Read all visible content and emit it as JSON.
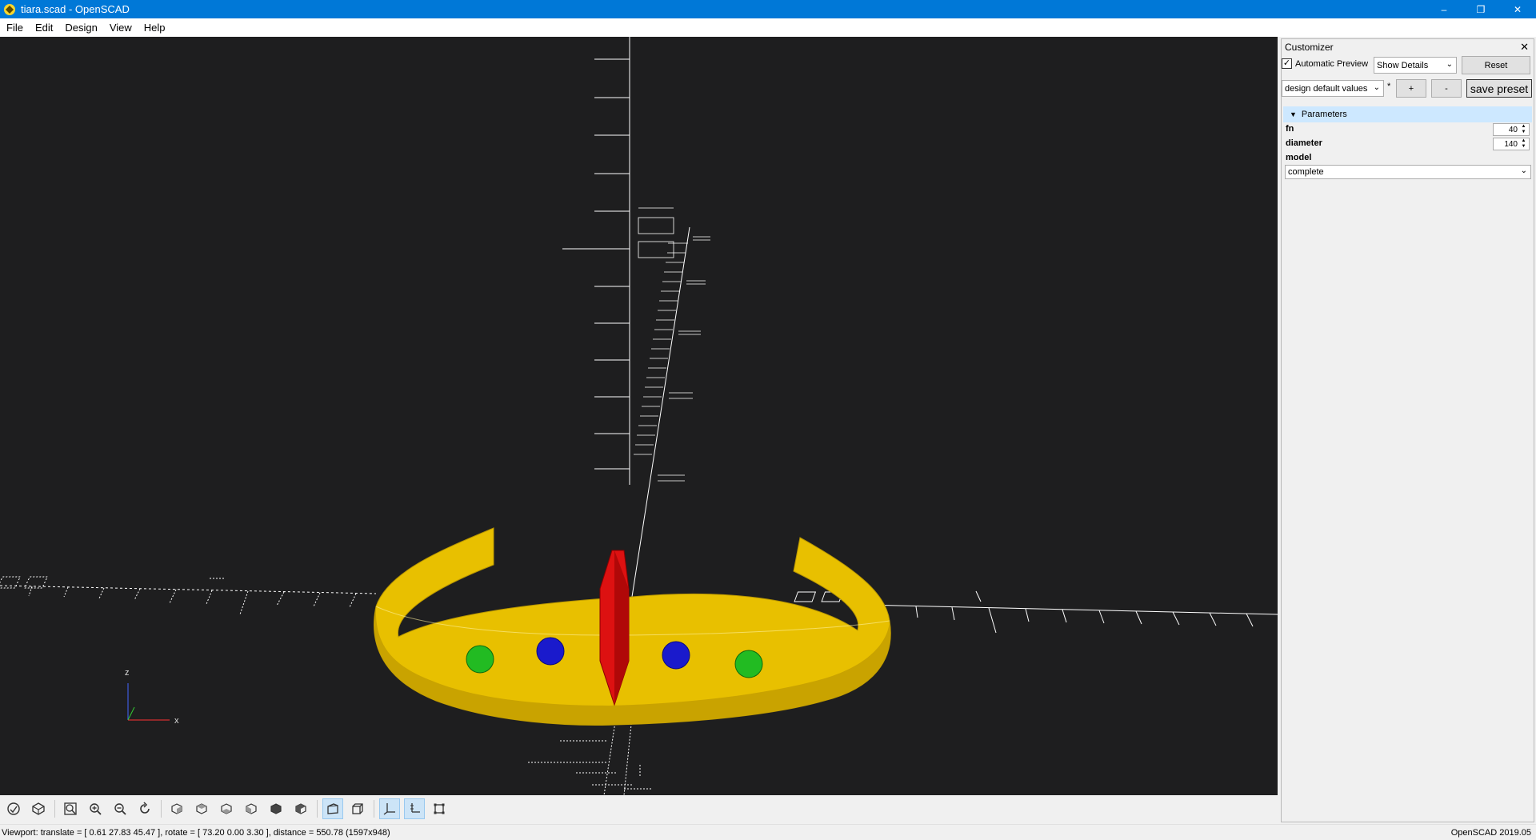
{
  "window": {
    "title": "tiara.scad - OpenSCAD",
    "titlebar_color": "#0078d7",
    "controls": {
      "minimize": "–",
      "maximize": "❐",
      "close": "✕"
    }
  },
  "menu": [
    "File",
    "Edit",
    "Design",
    "View",
    "Help"
  ],
  "viewport": {
    "background": "#1e1e1f",
    "model_colors": {
      "band": "#e8c000",
      "center_gem": "#dd1111",
      "side_gems": "#1a1acc",
      "outer_gems": "#22bb22"
    },
    "axis_labels": {
      "z": "z",
      "x": "x"
    }
  },
  "toolbar": {
    "buttons": [
      "preview-icon",
      "render-icon",
      "view-all-icon",
      "zoom-in-icon",
      "zoom-out-icon",
      "reset-view-icon",
      "view-right-icon",
      "view-top-icon",
      "view-bottom-icon",
      "view-left-icon",
      "view-front-icon",
      "view-back-icon",
      "perspective-icon",
      "orthogonal-icon",
      "show-axes-icon",
      "show-scale-markers-icon",
      "show-edges-icon"
    ],
    "active": [
      "perspective-icon",
      "show-axes-icon",
      "show-scale-markers-icon"
    ]
  },
  "status": {
    "viewport_text": "Viewport: translate = [ 0.61 27.83 45.47 ], rotate = [ 73.20 0.00 3.30 ], distance = 550.78 (1597x948)",
    "version": "OpenSCAD 2019.05"
  },
  "customizer": {
    "title": "Customizer",
    "close": "✕",
    "automatic_preview": {
      "label": "Automatic Preview",
      "checked": true,
      "mark": "✓"
    },
    "details_select": "Show Details",
    "reset_label": "Reset",
    "preset_select": "design default values",
    "preset_modified": "*",
    "add_label": "+",
    "remove_label": "-",
    "save_preset_label": "save preset",
    "parameters_header": "Parameters",
    "params": [
      {
        "name": "fn",
        "value": "40"
      },
      {
        "name": "diameter",
        "value": "140"
      }
    ],
    "model_label": "model",
    "model_value": "complete"
  }
}
